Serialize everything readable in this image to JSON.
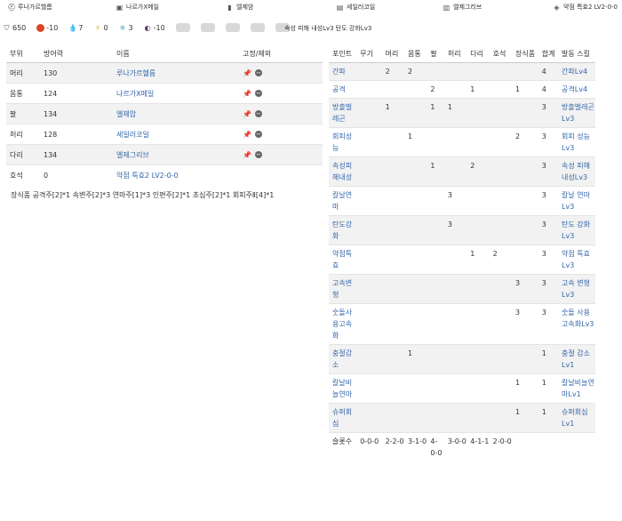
{
  "top_equipment": [
    {
      "icon": "weapon-icon",
      "name": "루나가르헬름"
    },
    {
      "icon": "chest-armor-icon",
      "name": "나르가X메일"
    },
    {
      "icon": "arm-armor-icon",
      "name": "엘제암"
    },
    {
      "icon": "waist-armor-icon",
      "name": "세일러코일"
    },
    {
      "icon": "leg-armor-icon",
      "name": "엘제그리브"
    },
    {
      "icon": "charm-icon",
      "name": "약점 특효2 LV2-0-0"
    }
  ],
  "stats": {
    "defense": "650",
    "fire": "-10",
    "water": "7",
    "thunder": "0",
    "ice": "3",
    "dragon": "-10"
  },
  "skills_summary": "속성 피해 내성Lv3   탄도 강화Lv3",
  "left_table": {
    "headers": [
      "부위",
      "방어력",
      "이름",
      "고정/제외"
    ],
    "rows": [
      {
        "part": "머리",
        "defense": "130",
        "name": "루나가르헬름"
      },
      {
        "part": "몸통",
        "defense": "124",
        "name": "나르가X메일"
      },
      {
        "part": "팔",
        "defense": "134",
        "name": "엘제암"
      },
      {
        "part": "허리",
        "defense": "128",
        "name": "세일러코일"
      },
      {
        "part": "다리",
        "defense": "134",
        "name": "엘제그리브"
      },
      {
        "part": "호석",
        "defense": "0",
        "name": "약점 특효2 LV2-0-0"
      }
    ],
    "decorations": "장식품  공격주[2]*1 속변주[2]*3 연마주[1]*3 인편주[2]*1 초심주[2]*1 회피주Ⅱ[4]*1"
  },
  "right_table": {
    "headers": [
      "포인트",
      "무기",
      "머리",
      "몸통",
      "팔",
      "허리",
      "다리",
      "호석",
      "장식품",
      "합계",
      "발동 스킬"
    ],
    "rows": [
      {
        "point": "간파",
        "weapon": "",
        "head": "2",
        "body": "2",
        "arm": "",
        "waist": "",
        "leg": "",
        "charm": "",
        "deco": "",
        "total": "4",
        "skill": "간파Lv4"
      },
      {
        "point": "공격",
        "weapon": "",
        "head": "",
        "body": "",
        "arm": "2",
        "waist": "",
        "leg": "1",
        "charm": "",
        "deco": "1",
        "total": "4",
        "skill": "공격Lv4"
      },
      {
        "point": "방출벌레곤",
        "weapon": "",
        "head": "1",
        "body": "",
        "arm": "1",
        "waist": "1",
        "leg": "",
        "charm": "",
        "deco": "",
        "total": "3",
        "skill": "방출벌레곤Lv3"
      },
      {
        "point": "회피성능",
        "weapon": "",
        "head": "",
        "body": "1",
        "arm": "",
        "waist": "",
        "leg": "",
        "charm": "",
        "deco": "2",
        "total": "3",
        "skill": "회피 성능Lv3"
      },
      {
        "point": "속성피해내성",
        "weapon": "",
        "head": "",
        "body": "",
        "arm": "1",
        "waist": "",
        "leg": "2",
        "charm": "",
        "deco": "",
        "total": "3",
        "skill": "속성 피해 내성Lv3"
      },
      {
        "point": "칼날연마",
        "weapon": "",
        "head": "",
        "body": "",
        "arm": "",
        "waist": "3",
        "leg": "",
        "charm": "",
        "deco": "",
        "total": "3",
        "skill": "칼날 연마Lv3"
      },
      {
        "point": "탄도강화",
        "weapon": "",
        "head": "",
        "body": "",
        "arm": "",
        "waist": "3",
        "leg": "",
        "charm": "",
        "deco": "",
        "total": "3",
        "skill": "탄도 강화Lv3"
      },
      {
        "point": "약점특효",
        "weapon": "",
        "head": "",
        "body": "",
        "arm": "",
        "waist": "",
        "leg": "1",
        "charm": "2",
        "deco": "",
        "total": "3",
        "skill": "약점 특효Lv3"
      },
      {
        "point": "고속변형",
        "weapon": "",
        "head": "",
        "body": "",
        "arm": "",
        "waist": "",
        "leg": "",
        "charm": "",
        "deco": "3",
        "total": "3",
        "skill": "고속 변형Lv3"
      },
      {
        "point": "숫돌사용고속화",
        "weapon": "",
        "head": "",
        "body": "",
        "arm": "",
        "waist": "",
        "leg": "",
        "charm": "",
        "deco": "3",
        "total": "3",
        "skill": "숫돌 사용 고속화Lv3"
      },
      {
        "point": "충절감소",
        "weapon": "",
        "head": "",
        "body": "1",
        "arm": "",
        "waist": "",
        "leg": "",
        "charm": "",
        "deco": "",
        "total": "1",
        "skill": "충절 감소Lv1"
      },
      {
        "point": "칼날비늘연마",
        "weapon": "",
        "head": "",
        "body": "",
        "arm": "",
        "waist": "",
        "leg": "",
        "charm": "",
        "deco": "1",
        "total": "1",
        "skill": "칼날비늘연마Lv1"
      },
      {
        "point": "슈퍼회심",
        "weapon": "",
        "head": "",
        "body": "",
        "arm": "",
        "waist": "",
        "leg": "",
        "charm": "",
        "deco": "1",
        "total": "1",
        "skill": "슈퍼회심Lv1"
      },
      {
        "point": "슬롯수",
        "weapon": "0-0-0",
        "head": "2-2-0",
        "body": "3-1-0",
        "arm": "4-0-0",
        "waist": "3-0-0",
        "leg": "4-1-1",
        "charm": "2-0-0",
        "deco": "",
        "total": "",
        "skill": ""
      }
    ]
  },
  "colors": {
    "link": "#3366aa",
    "row_alt": "#f2f2f2",
    "fire": "#dd4422",
    "water": "#3388cc",
    "thunder": "#ccaa00",
    "ice": "#66aacc",
    "dragon": "#553366"
  }
}
